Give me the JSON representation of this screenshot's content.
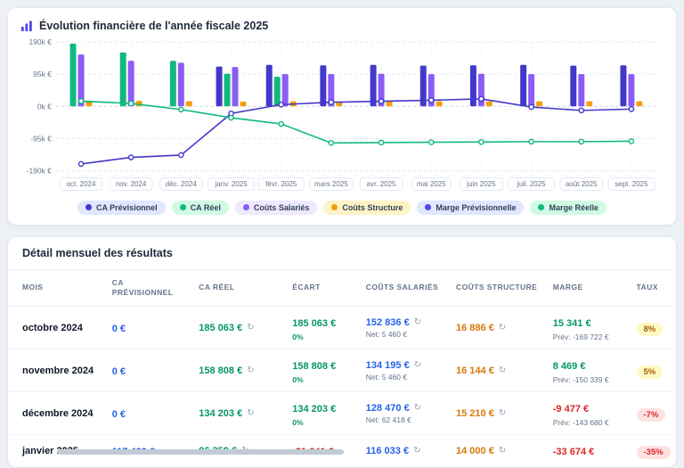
{
  "colors": {
    "pos": "#059669",
    "neg": "#dc2626",
    "blue": "#2563eb",
    "orange": "#d97706",
    "accent": "#4f46e5"
  },
  "chart": {
    "title": "Évolution financière de l'année fiscale 2025",
    "legend": [
      {
        "label": "CA Prévisionnel",
        "color": "#4338ca",
        "bg": "#e0e7ff"
      },
      {
        "label": "CA Réel",
        "color": "#10b981",
        "bg": "#d1fae5"
      },
      {
        "label": "Coûts Salariés",
        "color": "#8b5cf6",
        "bg": "#ede9fe"
      },
      {
        "label": "Coûts Structure",
        "color": "#f59e0b",
        "bg": "#fef3c7"
      },
      {
        "label": "Marge Prévisionnelle",
        "color": "#4f46e5",
        "bg": "#e0e7ff"
      },
      {
        "label": "Marge Réelle",
        "color": "#10b981",
        "bg": "#d1fae5"
      }
    ]
  },
  "chart_data": {
    "type": "bar+line",
    "categories": [
      "oct. 2024",
      "nov. 2024",
      "déc. 2024",
      "janv. 2025",
      "févr. 2025",
      "mars 2025",
      "avr. 2025",
      "mai 2025",
      "juin 2025",
      "juil. 2025",
      "août 2025",
      "sept. 2025"
    ],
    "y_ticks": [
      "190k €",
      "95k €",
      "0k €",
      "-95k €",
      "-190k €"
    ],
    "y_tick_values": [
      190000,
      95000,
      0,
      -95000,
      -190000
    ],
    "ylim": [
      -190000,
      190000
    ],
    "grid": true,
    "legend_position": "bottom",
    "bar_series": [
      {
        "name": "CA Prévisionnel",
        "color": "#4338ca",
        "values": [
          0,
          0,
          0,
          117400,
          122000,
          121000,
          122000,
          120000,
          121000,
          122000,
          120000,
          121000
        ]
      },
      {
        "name": "CA Réel",
        "color": "#10b981",
        "values": [
          185063,
          158808,
          134203,
          96359,
          87000,
          0,
          0,
          0,
          0,
          0,
          0,
          0
        ]
      },
      {
        "name": "Coûts Salariés",
        "color": "#8b5cf6",
        "values": [
          152836,
          134195,
          128470,
          116033,
          95000,
          95000,
          96000,
          95000,
          96000,
          95000,
          95000,
          95000
        ]
      },
      {
        "name": "Coûts Structure",
        "color": "#f59e0b",
        "values": [
          16886,
          16144,
          15210,
          14000,
          15000,
          15000,
          15000,
          15000,
          15000,
          15000,
          15000,
          15000
        ]
      }
    ],
    "line_series": [
      {
        "name": "Marge Prévisionnelle",
        "color": "#4338ca",
        "values": [
          -169722,
          -150339,
          -143680,
          -21041,
          5000,
          12000,
          15000,
          18000,
          22000,
          -2000,
          -12000,
          -8000
        ]
      },
      {
        "name": "Marge Réelle",
        "color": "#10b981",
        "values": [
          15341,
          8469,
          -9477,
          -33674,
          -52000,
          -108000,
          -107000,
          -106000,
          -105000,
          -104000,
          -104000,
          -103000
        ]
      }
    ]
  },
  "table": {
    "title": "Détail mensuel des résultats",
    "columns": [
      {
        "key": "mois",
        "label": "MOIS"
      },
      {
        "key": "ca_prev",
        "label": "CA PRÉVISIONNEL"
      },
      {
        "key": "ca_reel",
        "label": "CA RÉEL"
      },
      {
        "key": "ecart",
        "label": "ÉCART"
      },
      {
        "key": "salaries",
        "label": "COÛTS SALARIÉS"
      },
      {
        "key": "structure",
        "label": "COÛTS STRUCTURE"
      },
      {
        "key": "marge",
        "label": "MARGE"
      },
      {
        "key": "taux",
        "label": "TAUX"
      }
    ],
    "rows": [
      {
        "mois": "octobre 2024",
        "ca_prev": "0 €",
        "ca_reel": "185 063 €",
        "ecart": "185 063 €",
        "ecart_sub": "0%",
        "ecart_tone": "pos",
        "salaries": "152 836 €",
        "salaries_sub": "Net: 5 460 €",
        "structure": "16 886 €",
        "marge": "15 341 €",
        "marge_sub": "Prév: -169 722 €",
        "marge_tone": "pos",
        "taux": "8%",
        "taux_tone": "warn"
      },
      {
        "mois": "novembre 2024",
        "ca_prev": "0 €",
        "ca_reel": "158 808 €",
        "ecart": "158 808 €",
        "ecart_sub": "0%",
        "ecart_tone": "pos",
        "salaries": "134 195 €",
        "salaries_sub": "Net: 5 460 €",
        "structure": "16 144 €",
        "marge": "8 469 €",
        "marge_sub": "Prév: -150 339 €",
        "marge_tone": "pos",
        "taux": "5%",
        "taux_tone": "warn"
      },
      {
        "mois": "décembre 2024",
        "ca_prev": "0 €",
        "ca_reel": "134 203 €",
        "ecart": "134 203 €",
        "ecart_sub": "0%",
        "ecart_tone": "pos",
        "salaries": "128 470 €",
        "salaries_sub": "Net: 62 418 €",
        "structure": "15 210 €",
        "marge": "-9 477 €",
        "marge_sub": "Prév: -143 680 €",
        "marge_tone": "neg",
        "taux": "-7%",
        "taux_tone": "danger"
      },
      {
        "mois": "janvier 2025",
        "ca_prev": "117 400 €",
        "ca_reel": "96 359 €",
        "ecart": "-21 041 €",
        "ecart_sub": "",
        "ecart_tone": "neg",
        "salaries": "116 033 €",
        "salaries_sub": "",
        "structure": "14 000 €",
        "marge": "-33 674 €",
        "marge_sub": "",
        "marge_tone": "neg",
        "taux": "-35%",
        "taux_tone": "danger"
      }
    ]
  }
}
